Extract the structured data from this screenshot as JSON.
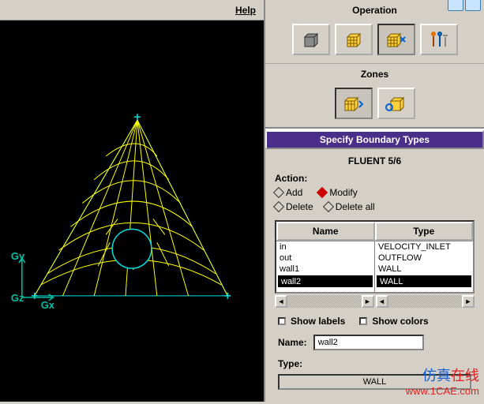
{
  "menu": {
    "help": "Help"
  },
  "viewport": {
    "axes": {
      "y": "Gy",
      "z": "Gz",
      "x": "Gx"
    }
  },
  "operation": {
    "title": "Operation"
  },
  "zones": {
    "title": "Zones"
  },
  "panel": {
    "header": "Specify Boundary Types",
    "solver": "FLUENT 5/6",
    "action_label": "Action:",
    "actions": {
      "add": "Add",
      "modify": "Modify",
      "delete": "Delete",
      "delete_all": "Delete all"
    },
    "columns": {
      "name": "Name",
      "type": "Type"
    },
    "rows": [
      {
        "name": "in",
        "type": "VELOCITY_INLET"
      },
      {
        "name": "out",
        "type": "OUTFLOW"
      },
      {
        "name": "wall1",
        "type": "WALL"
      },
      {
        "name": "wall2",
        "type": "WALL"
      }
    ],
    "show_labels": "Show labels",
    "show_colors": "Show colors",
    "name_label": "Name:",
    "name_value": "wall2",
    "type_label": "Type:",
    "type_value": "WALL"
  },
  "watermark": {
    "cn_prefix": "仿真",
    "cn_hl": "在线",
    "url": "www.1CAE.com"
  }
}
